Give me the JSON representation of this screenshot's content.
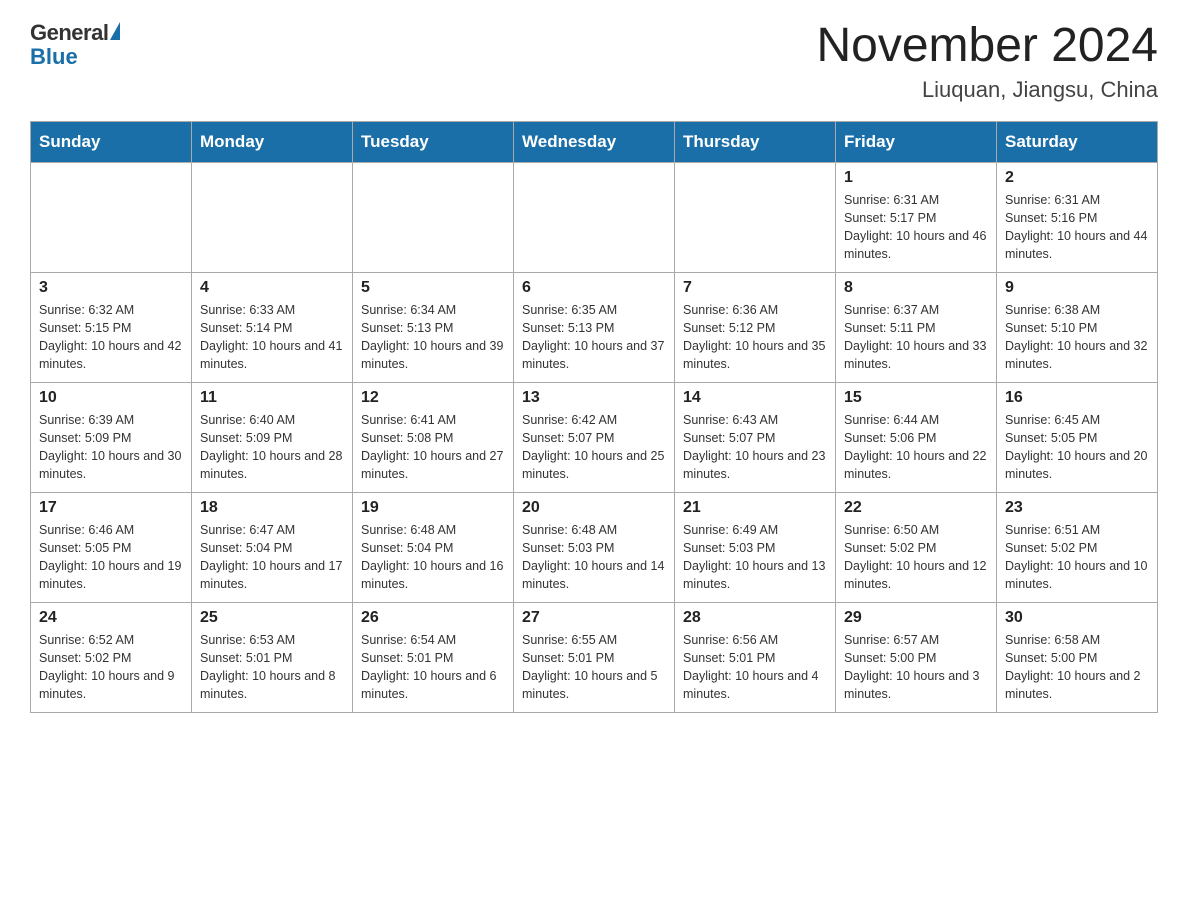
{
  "header": {
    "logo_general": "General",
    "logo_blue": "Blue",
    "month_title": "November 2024",
    "location": "Liuquan, Jiangsu, China"
  },
  "weekdays": [
    "Sunday",
    "Monday",
    "Tuesday",
    "Wednesday",
    "Thursday",
    "Friday",
    "Saturday"
  ],
  "weeks": [
    [
      {
        "day": "",
        "sunrise": "",
        "sunset": "",
        "daylight": ""
      },
      {
        "day": "",
        "sunrise": "",
        "sunset": "",
        "daylight": ""
      },
      {
        "day": "",
        "sunrise": "",
        "sunset": "",
        "daylight": ""
      },
      {
        "day": "",
        "sunrise": "",
        "sunset": "",
        "daylight": ""
      },
      {
        "day": "",
        "sunrise": "",
        "sunset": "",
        "daylight": ""
      },
      {
        "day": "1",
        "sunrise": "Sunrise: 6:31 AM",
        "sunset": "Sunset: 5:17 PM",
        "daylight": "Daylight: 10 hours and 46 minutes."
      },
      {
        "day": "2",
        "sunrise": "Sunrise: 6:31 AM",
        "sunset": "Sunset: 5:16 PM",
        "daylight": "Daylight: 10 hours and 44 minutes."
      }
    ],
    [
      {
        "day": "3",
        "sunrise": "Sunrise: 6:32 AM",
        "sunset": "Sunset: 5:15 PM",
        "daylight": "Daylight: 10 hours and 42 minutes."
      },
      {
        "day": "4",
        "sunrise": "Sunrise: 6:33 AM",
        "sunset": "Sunset: 5:14 PM",
        "daylight": "Daylight: 10 hours and 41 minutes."
      },
      {
        "day": "5",
        "sunrise": "Sunrise: 6:34 AM",
        "sunset": "Sunset: 5:13 PM",
        "daylight": "Daylight: 10 hours and 39 minutes."
      },
      {
        "day": "6",
        "sunrise": "Sunrise: 6:35 AM",
        "sunset": "Sunset: 5:13 PM",
        "daylight": "Daylight: 10 hours and 37 minutes."
      },
      {
        "day": "7",
        "sunrise": "Sunrise: 6:36 AM",
        "sunset": "Sunset: 5:12 PM",
        "daylight": "Daylight: 10 hours and 35 minutes."
      },
      {
        "day": "8",
        "sunrise": "Sunrise: 6:37 AM",
        "sunset": "Sunset: 5:11 PM",
        "daylight": "Daylight: 10 hours and 33 minutes."
      },
      {
        "day": "9",
        "sunrise": "Sunrise: 6:38 AM",
        "sunset": "Sunset: 5:10 PM",
        "daylight": "Daylight: 10 hours and 32 minutes."
      }
    ],
    [
      {
        "day": "10",
        "sunrise": "Sunrise: 6:39 AM",
        "sunset": "Sunset: 5:09 PM",
        "daylight": "Daylight: 10 hours and 30 minutes."
      },
      {
        "day": "11",
        "sunrise": "Sunrise: 6:40 AM",
        "sunset": "Sunset: 5:09 PM",
        "daylight": "Daylight: 10 hours and 28 minutes."
      },
      {
        "day": "12",
        "sunrise": "Sunrise: 6:41 AM",
        "sunset": "Sunset: 5:08 PM",
        "daylight": "Daylight: 10 hours and 27 minutes."
      },
      {
        "day": "13",
        "sunrise": "Sunrise: 6:42 AM",
        "sunset": "Sunset: 5:07 PM",
        "daylight": "Daylight: 10 hours and 25 minutes."
      },
      {
        "day": "14",
        "sunrise": "Sunrise: 6:43 AM",
        "sunset": "Sunset: 5:07 PM",
        "daylight": "Daylight: 10 hours and 23 minutes."
      },
      {
        "day": "15",
        "sunrise": "Sunrise: 6:44 AM",
        "sunset": "Sunset: 5:06 PM",
        "daylight": "Daylight: 10 hours and 22 minutes."
      },
      {
        "day": "16",
        "sunrise": "Sunrise: 6:45 AM",
        "sunset": "Sunset: 5:05 PM",
        "daylight": "Daylight: 10 hours and 20 minutes."
      }
    ],
    [
      {
        "day": "17",
        "sunrise": "Sunrise: 6:46 AM",
        "sunset": "Sunset: 5:05 PM",
        "daylight": "Daylight: 10 hours and 19 minutes."
      },
      {
        "day": "18",
        "sunrise": "Sunrise: 6:47 AM",
        "sunset": "Sunset: 5:04 PM",
        "daylight": "Daylight: 10 hours and 17 minutes."
      },
      {
        "day": "19",
        "sunrise": "Sunrise: 6:48 AM",
        "sunset": "Sunset: 5:04 PM",
        "daylight": "Daylight: 10 hours and 16 minutes."
      },
      {
        "day": "20",
        "sunrise": "Sunrise: 6:48 AM",
        "sunset": "Sunset: 5:03 PM",
        "daylight": "Daylight: 10 hours and 14 minutes."
      },
      {
        "day": "21",
        "sunrise": "Sunrise: 6:49 AM",
        "sunset": "Sunset: 5:03 PM",
        "daylight": "Daylight: 10 hours and 13 minutes."
      },
      {
        "day": "22",
        "sunrise": "Sunrise: 6:50 AM",
        "sunset": "Sunset: 5:02 PM",
        "daylight": "Daylight: 10 hours and 12 minutes."
      },
      {
        "day": "23",
        "sunrise": "Sunrise: 6:51 AM",
        "sunset": "Sunset: 5:02 PM",
        "daylight": "Daylight: 10 hours and 10 minutes."
      }
    ],
    [
      {
        "day": "24",
        "sunrise": "Sunrise: 6:52 AM",
        "sunset": "Sunset: 5:02 PM",
        "daylight": "Daylight: 10 hours and 9 minutes."
      },
      {
        "day": "25",
        "sunrise": "Sunrise: 6:53 AM",
        "sunset": "Sunset: 5:01 PM",
        "daylight": "Daylight: 10 hours and 8 minutes."
      },
      {
        "day": "26",
        "sunrise": "Sunrise: 6:54 AM",
        "sunset": "Sunset: 5:01 PM",
        "daylight": "Daylight: 10 hours and 6 minutes."
      },
      {
        "day": "27",
        "sunrise": "Sunrise: 6:55 AM",
        "sunset": "Sunset: 5:01 PM",
        "daylight": "Daylight: 10 hours and 5 minutes."
      },
      {
        "day": "28",
        "sunrise": "Sunrise: 6:56 AM",
        "sunset": "Sunset: 5:01 PM",
        "daylight": "Daylight: 10 hours and 4 minutes."
      },
      {
        "day": "29",
        "sunrise": "Sunrise: 6:57 AM",
        "sunset": "Sunset: 5:00 PM",
        "daylight": "Daylight: 10 hours and 3 minutes."
      },
      {
        "day": "30",
        "sunrise": "Sunrise: 6:58 AM",
        "sunset": "Sunset: 5:00 PM",
        "daylight": "Daylight: 10 hours and 2 minutes."
      }
    ]
  ]
}
